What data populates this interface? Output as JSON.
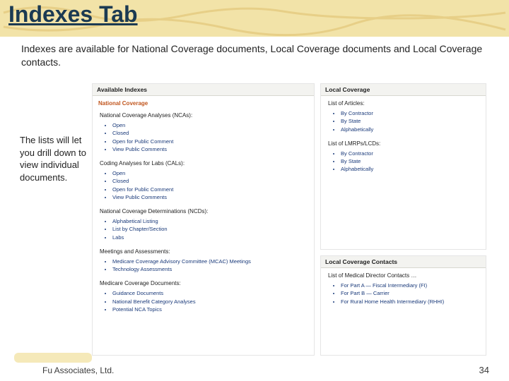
{
  "slide": {
    "title": "Indexes Tab",
    "intro": "Indexes are available for National Coverage documents, Local Coverage documents and Local Coverage contacts.",
    "sidenote": "The lists will let you drill down to view individual documents.",
    "footer_left": "Fu Associates, Ltd.",
    "page_number": "34"
  },
  "left_panel": {
    "title": "Available Indexes",
    "section_head": "National Coverage",
    "groups": [
      {
        "label": "National Coverage Analyses (NCAs):",
        "items": [
          "Open",
          "Closed",
          "Open for Public Comment",
          "View Public Comments"
        ]
      },
      {
        "label": "Coding Analyses for Labs (CALs):",
        "items": [
          "Open",
          "Closed",
          "Open for Public Comment",
          "View Public Comments"
        ]
      },
      {
        "label": "National Coverage Determinations (NCDs):",
        "items": [
          "Alphabetical Listing",
          "List by Chapter/Section",
          "Labs"
        ]
      },
      {
        "label": "Meetings and Assessments:",
        "items": [
          "Medicare Coverage Advisory Committee (MCAC) Meetings",
          "Technology Assessments"
        ]
      },
      {
        "label": "Medicare Coverage Documents:",
        "items": [
          "Guidance Documents",
          "National Benefit Category Analyses",
          "Potential NCA Topics"
        ]
      }
    ]
  },
  "right_panel_top": {
    "title": "Local Coverage",
    "groups": [
      {
        "label": "List of Articles:",
        "items": [
          "By Contractor",
          "By State",
          "Alphabetically"
        ]
      },
      {
        "label": "List of LMRPs/LCDs:",
        "items": [
          "By Contractor",
          "By State",
          "Alphabetically"
        ]
      }
    ]
  },
  "right_panel_bottom": {
    "title": "Local Coverage Contacts",
    "groups": [
      {
        "label": "List of Medical Director Contacts …",
        "items": [
          "For Part A — Fiscal Intermediary (FI)",
          "For Part B — Carrier",
          "For Rural Home Health Intermediary (RHHI)"
        ]
      }
    ]
  }
}
